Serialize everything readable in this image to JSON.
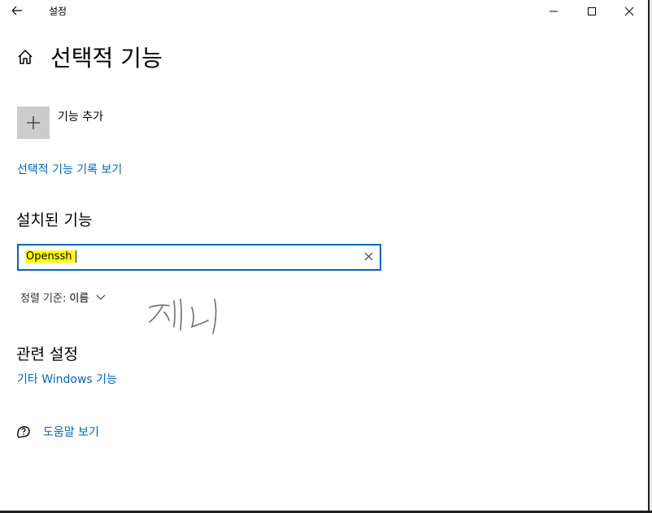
{
  "window": {
    "title": "설정",
    "back_label": "뒤로",
    "minimize_label": "최소화",
    "maximize_label": "최대화",
    "close_label": "닫기"
  },
  "page": {
    "title": "선택적 기능"
  },
  "add_feature": {
    "label": "기능 추가",
    "icon": "plus-icon"
  },
  "history_link": "선택적 기능 기록 보기",
  "installed": {
    "heading": "설치된 기능",
    "search_value": "Openssh",
    "sort_label": "정렬 기준:",
    "sort_value": "이름"
  },
  "related": {
    "heading": "관련 설정",
    "windows_features_link": "기타 Windows 기능"
  },
  "help": {
    "label": "도움말 보기",
    "icon": "help-chat-icon"
  },
  "colors": {
    "accent": "#0067b8",
    "highlight": "#ffff00",
    "tile": "#cccccc"
  }
}
